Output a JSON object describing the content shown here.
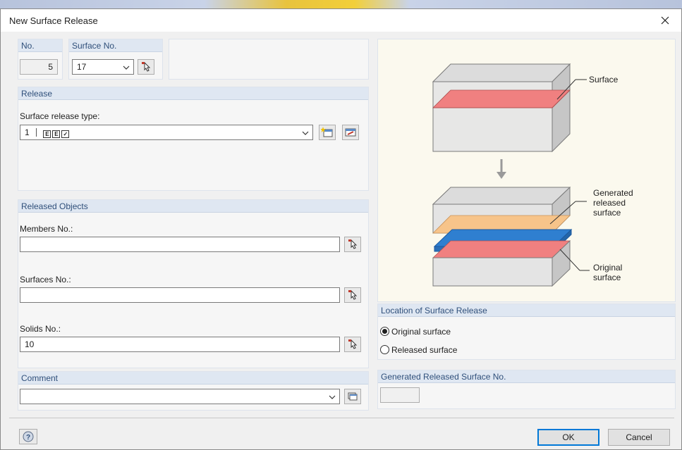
{
  "window": {
    "title": "New Surface Release"
  },
  "header": {
    "no_label": "No.",
    "no_value": "5",
    "surface_no_label": "Surface No.",
    "surface_no_value": "17"
  },
  "release": {
    "title": "Release",
    "type_label": "Surface release type:",
    "type_value_no": "1"
  },
  "released_objects": {
    "title": "Released Objects",
    "members_label": "Members No.:",
    "members_value": "",
    "surfaces_label": "Surfaces No.:",
    "surfaces_value": "",
    "solids_label": "Solids No.:",
    "solids_value": "10"
  },
  "comment": {
    "title": "Comment",
    "value": ""
  },
  "diagram": {
    "label_surface": "Surface",
    "label_generated": [
      "Generated",
      "released",
      "surface"
    ],
    "label_original": [
      "Original",
      "surface"
    ]
  },
  "location": {
    "title": "Location of Surface Release",
    "options": [
      {
        "label": "Original surface",
        "selected": true
      },
      {
        "label": "Released surface",
        "selected": false
      }
    ]
  },
  "generated_no": {
    "title": "Generated Released Surface No.",
    "value": ""
  },
  "footer": {
    "ok_label": "OK",
    "cancel_label": "Cancel"
  },
  "colors": {
    "panel_header": "#dfe7f2",
    "accent": "#0078d7",
    "surface_red": "#f08080",
    "release_orange": "#f7c48a",
    "release_blue": "#2f7fd0"
  }
}
